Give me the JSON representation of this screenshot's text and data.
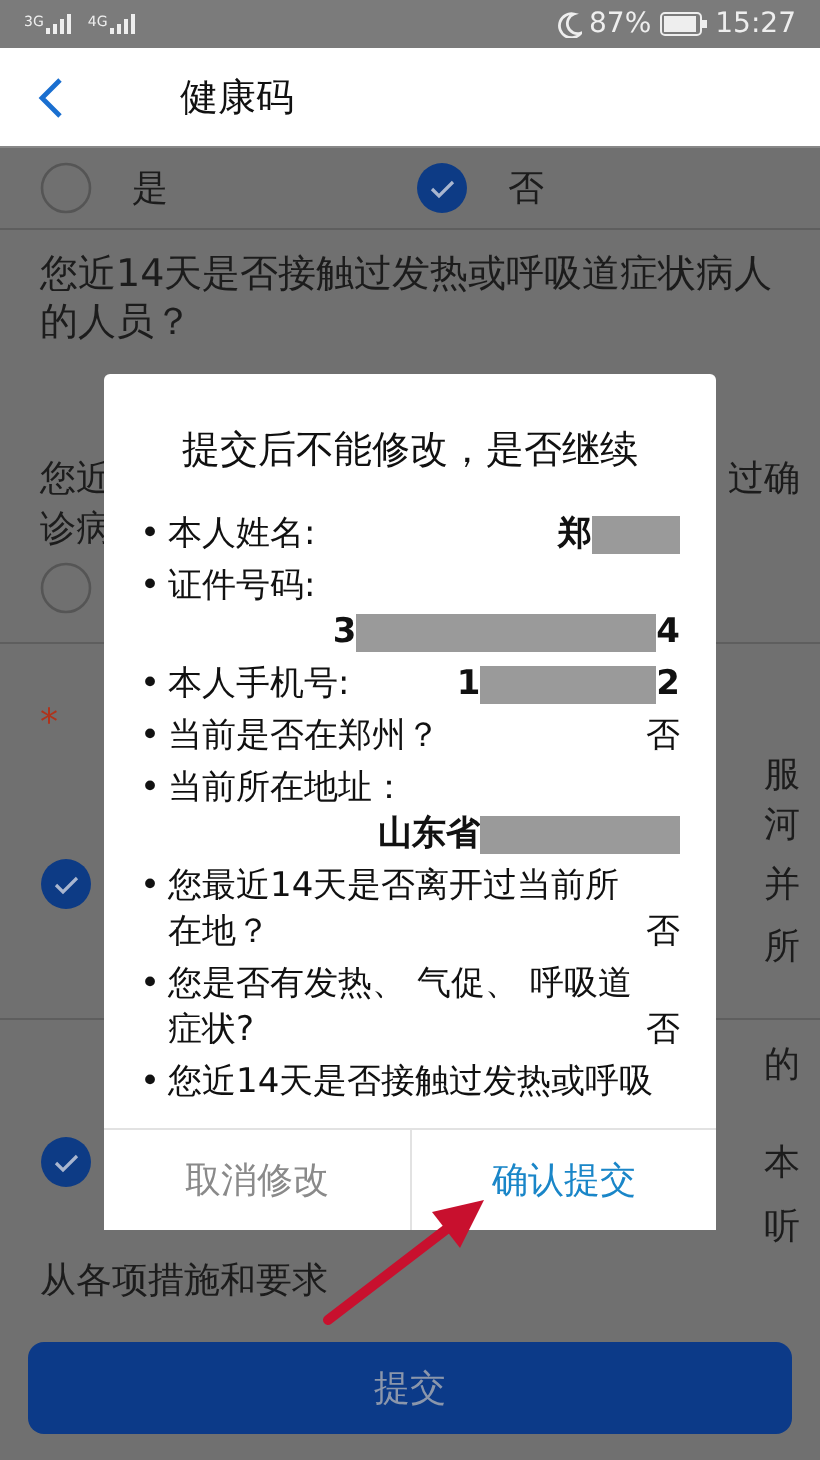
{
  "status_bar": {
    "networks": [
      "3G",
      "4G"
    ],
    "battery": "87%",
    "time": "15:27"
  },
  "header": {
    "title": "健康码"
  },
  "form": {
    "sections": [
      {
        "rows": [
          {
            "kind": "radios",
            "options": [
              {
                "label": "是",
                "selected": false
              },
              {
                "label": "否",
                "selected": true
              }
            ]
          }
        ]
      },
      {
        "rows": [
          {
            "kind": "question",
            "text": "您近14天是否接触过发热或呼吸道症状病人的人员？"
          },
          {
            "kind": "line",
            "left": "您近",
            "right": "过确"
          },
          {
            "kind": "line",
            "left": "诊病"
          },
          {
            "kind": "radio",
            "selected": false
          }
        ]
      },
      {
        "rows": [
          {
            "kind": "line",
            "required_mark": "*"
          },
          {
            "kind": "line",
            "right": "服"
          },
          {
            "kind": "line",
            "right": "河"
          },
          {
            "kind": "radio",
            "selected": true,
            "right": "并"
          },
          {
            "kind": "line",
            "right": "所"
          }
        ]
      },
      {
        "rows": [
          {
            "kind": "line",
            "right": "的"
          },
          {
            "kind": "radio",
            "selected": true,
            "right": "本"
          },
          {
            "kind": "line",
            "right": "听"
          },
          {
            "kind": "line",
            "left": "从各项措施和要求"
          }
        ]
      }
    ]
  },
  "submit": {
    "label": "提交"
  },
  "dialog": {
    "title": "提交后不能修改，是否继续",
    "items": [
      {
        "kind": "inline",
        "marker": "•",
        "label": "本人姓名:",
        "value_start": "郑",
        "masked": true
      },
      {
        "kind": "block",
        "marker": "•",
        "label": "证件号码:",
        "value_start": "3",
        "masked": true,
        "value_end": "4"
      },
      {
        "kind": "inline",
        "marker": "•",
        "label": "本人手机号:",
        "value_start": "1",
        "masked": true,
        "value_end": "2"
      },
      {
        "kind": "inline",
        "marker": "•",
        "label": "当前是否在郑州？",
        "value_start": "否",
        "masked": false
      },
      {
        "kind": "block",
        "marker": "•",
        "label": "当前所在地址：",
        "value_start": "山东省",
        "masked": true
      },
      {
        "kind": "wrap",
        "marker": "•",
        "label": "您最近14天是否离开过当前所在地？",
        "value_start": "否",
        "masked": false
      },
      {
        "kind": "wrap",
        "marker": "•",
        "label": "您是否有发热、 气促、 呼吸道症状?",
        "value_start": "否",
        "masked": false
      },
      {
        "kind": "cut",
        "marker": "•",
        "label": "您近14天是否接触过发热或呼吸"
      }
    ],
    "buttons": [
      {
        "kind": "cancel",
        "label": "取消修改"
      },
      {
        "kind": "confirm",
        "label": "确认提交"
      }
    ]
  }
}
